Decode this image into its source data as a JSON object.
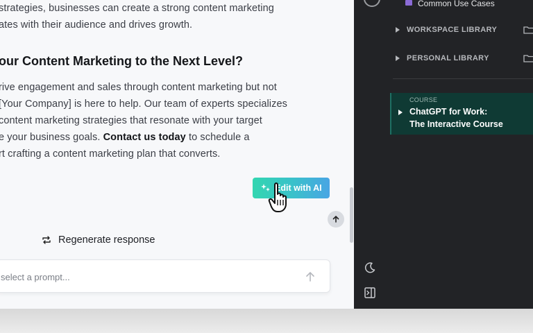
{
  "chat": {
    "lines": [
      "strategies, businesses can create a strong content marketing",
      "ates with their audience and drives growth."
    ],
    "heading": "our Content Marketing to the Next Level?",
    "para": [
      "rive engagement and sales through content marketing but not",
      "[Your Company] is here to help. Our team of experts specializes",
      "content marketing strategies that resonate with your target",
      "e your business goals. "
    ],
    "para_bold": "Contact us today",
    "para_tail": " to schedule a",
    "para_last": "rt crafting a content marketing plan that converts.",
    "edit_ai_label": "Edit with AI",
    "regenerate_label": "Regenerate response",
    "prompt_placeholder": "select a prompt..."
  },
  "sidebar": {
    "common_use_cases": "Common Use Cases",
    "workspace_library": "WORKSPACE LIBRARY",
    "personal_library": "PERSONAL LIBRARY",
    "course": {
      "tag": "COURSE",
      "title_line1": "ChatGPT for Work:",
      "title_line2": "The Interactive Course"
    }
  },
  "colors": {
    "accent_start": "#33d6b0",
    "accent_end": "#49a5e4",
    "sidebar_bg": "#222326",
    "course_bg": "#0f3a34",
    "folder_purple": "#8b6bd6"
  },
  "icons": {
    "edit_ai": "sparkle-icon",
    "cursor": "hand-pointer-cursor",
    "regenerate": "repeat-arrows-icon",
    "send": "arrow-up-icon",
    "scroll_up": "arrow-up-icon",
    "library_add": "folder-add-icon",
    "moon": "moon-icon",
    "collapse": "sidebar-collapse-icon"
  }
}
